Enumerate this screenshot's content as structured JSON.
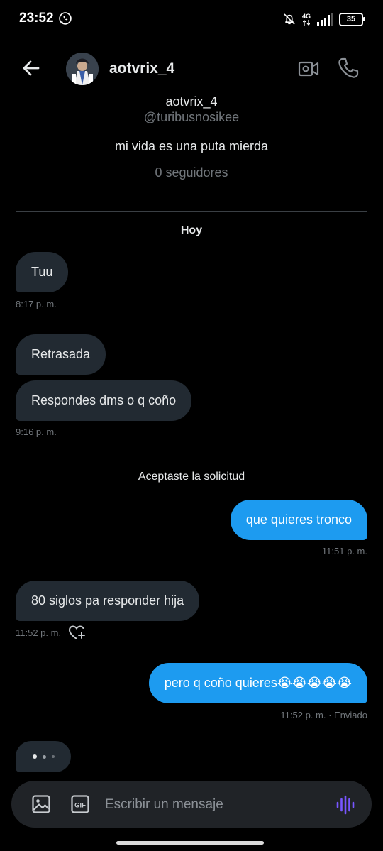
{
  "status_bar": {
    "time": "23:52",
    "network": "4G",
    "battery": "35"
  },
  "header": {
    "username": "aotvrix_4"
  },
  "profile": {
    "name": "aotvrix_4",
    "handle": "@turibusnosikee",
    "bio": "mi vida es una puta mierda",
    "followers": "0 seguidores"
  },
  "conversation": {
    "day_label": "Hoy",
    "messages": [
      {
        "text": "Tuu",
        "direction": "in"
      },
      {
        "text": "Retrasada",
        "direction": "in"
      },
      {
        "text": "Respondes dms o q coño",
        "direction": "in"
      },
      {
        "text": "que quieres tronco",
        "direction": "out"
      },
      {
        "text": "80 siglos pa responder hija",
        "direction": "in"
      },
      {
        "text": "pero q coño quieres😭😭😭😭😭",
        "direction": "out"
      }
    ],
    "timestamps": [
      "8:17 p. m.",
      "9:16 p. m.",
      "11:51 p. m.",
      "11:52 p. m.",
      "11:52 p. m. · Enviado"
    ],
    "system_note": "Aceptaste la solicitud"
  },
  "composer": {
    "placeholder": "Escribir un mensaje",
    "gif_label": "GIF"
  },
  "colors": {
    "background": "#000000",
    "incoming_bubble": "#222a32",
    "outgoing_bubble": "#1d9bf0",
    "muted_text": "#71767b",
    "voice_accent": "#7856ff"
  }
}
